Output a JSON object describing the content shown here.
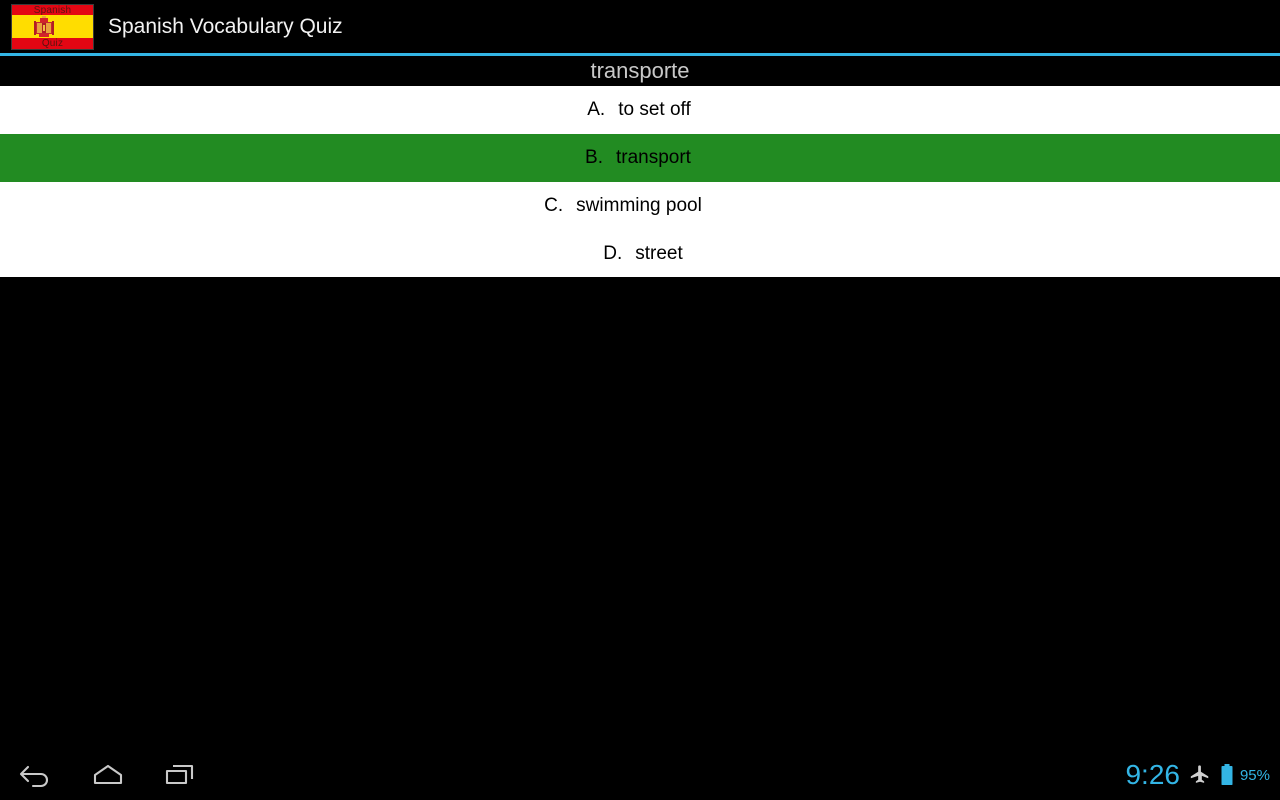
{
  "app": {
    "title": "Spanish Vocabulary Quiz",
    "icon": {
      "name": "spanish-flag-quiz-icon",
      "top_text": "Spanish",
      "bottom_text": "Quiz",
      "flag_red": "#e30613",
      "flag_yellow": "#ffdd00"
    },
    "accent_color": "#33b5e5"
  },
  "quiz": {
    "question_word": "transporte",
    "selected_letter": "B",
    "selected_color": "#228b22",
    "options": [
      {
        "letter": "A.",
        "text": "to set off",
        "selected": false
      },
      {
        "letter": "B.",
        "text": "transport",
        "selected": true
      },
      {
        "letter": "C.",
        "text": "swimming pool",
        "selected": false
      },
      {
        "letter": "D.",
        "text": "street",
        "selected": false
      }
    ]
  },
  "system_bar": {
    "back_icon": "back-arrow-icon",
    "home_icon": "home-icon",
    "recents_icon": "recent-apps-icon",
    "clock": "9:26",
    "airplane_icon": "airplane-mode-icon",
    "battery_icon": "battery-icon",
    "battery_percent": "95%",
    "text_color": "#33b5e5"
  }
}
